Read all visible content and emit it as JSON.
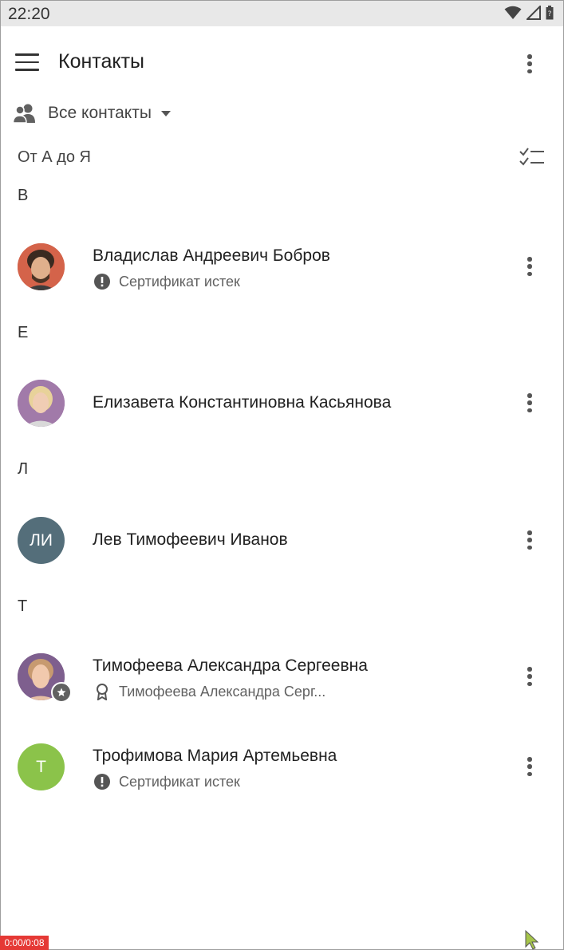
{
  "status_bar": {
    "time": "22:20"
  },
  "app_bar": {
    "title": "Контакты"
  },
  "filter": {
    "label": "Все контакты"
  },
  "sort": {
    "label": "От А до Я"
  },
  "sections": [
    {
      "letter": "В"
    },
    {
      "letter": "Е"
    },
    {
      "letter": "Л"
    },
    {
      "letter": "Т"
    }
  ],
  "contacts": [
    {
      "name": "Владислав Андреевич Бобров",
      "subtitle": "Сертификат истек",
      "subtitle_icon": "alert-circle-icon"
    },
    {
      "name": "Елизавета Константиновна Касьянова"
    },
    {
      "name": "Лев Тимофеевич Иванов",
      "initials": "ЛИ",
      "avatar_color": "#546e7a"
    },
    {
      "name": "Тимофеева Александра Сергеевна",
      "subtitle": "Тимофеева Александра Серг...",
      "subtitle_icon": "certificate-icon"
    },
    {
      "name": "Трофимова Мария Артемьевна",
      "subtitle": "Сертификат истек",
      "subtitle_icon": "alert-circle-icon",
      "initials": "Т",
      "avatar_color": "#8bc34a"
    }
  ],
  "recording": {
    "timer": "0:00/0:08"
  }
}
